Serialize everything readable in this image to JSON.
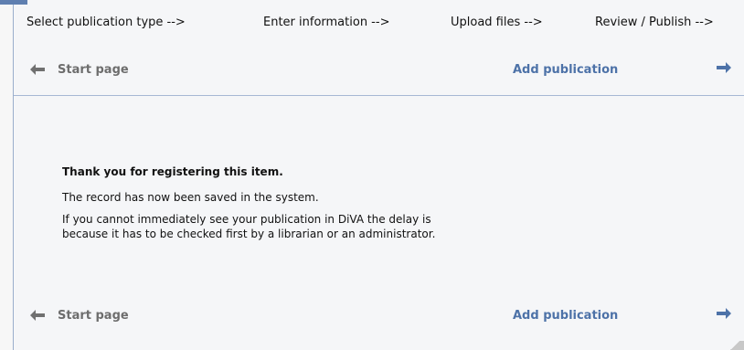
{
  "steps": [
    "Select publication type -->",
    "Enter information -->",
    "Upload files -->",
    "Review / Publish -->"
  ],
  "nav": {
    "start_label": "Start page",
    "add_label": "Add publication",
    "left_icon": "arrow-left-icon",
    "right_icon": "arrow-right-icon"
  },
  "content": {
    "thanks": "Thank you for registering this item.",
    "saved": "The record has now been saved in the system.",
    "delay_line1": "If you cannot immediately see your publication in DiVA the delay is",
    "delay_line2": "because it has to be checked first by a librarian or an administrator."
  },
  "colors": {
    "link": "#4d72a8",
    "muted": "#6d6d6d",
    "border": "#a7b8d4",
    "accent": "#5f7fb0"
  }
}
